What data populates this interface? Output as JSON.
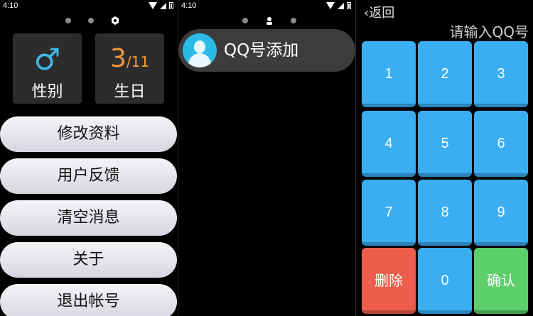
{
  "status": {
    "time": "4:10"
  },
  "profile": {
    "gender_label": "性别",
    "gender_symbol": "♂",
    "birthday_label": "生日",
    "birthday_month": "3",
    "birthday_day": "/11",
    "menu": [
      "修改资料",
      "用户反馈",
      "清空消息",
      "关于",
      "退出帐号"
    ]
  },
  "add": {
    "qq_add_label": "QQ号添加"
  },
  "keypad": {
    "back_label": "‹返回",
    "prompt": "请输入QQ号",
    "keys": [
      "1",
      "2",
      "3",
      "4",
      "5",
      "6",
      "7",
      "8",
      "9",
      "删除",
      "0",
      "确认"
    ]
  },
  "colors": {
    "accent_blue": "#3aaef0",
    "delete_red": "#ee5d4b",
    "confirm_green": "#5ccf6a",
    "birthday_orange": "#f29b3b"
  }
}
